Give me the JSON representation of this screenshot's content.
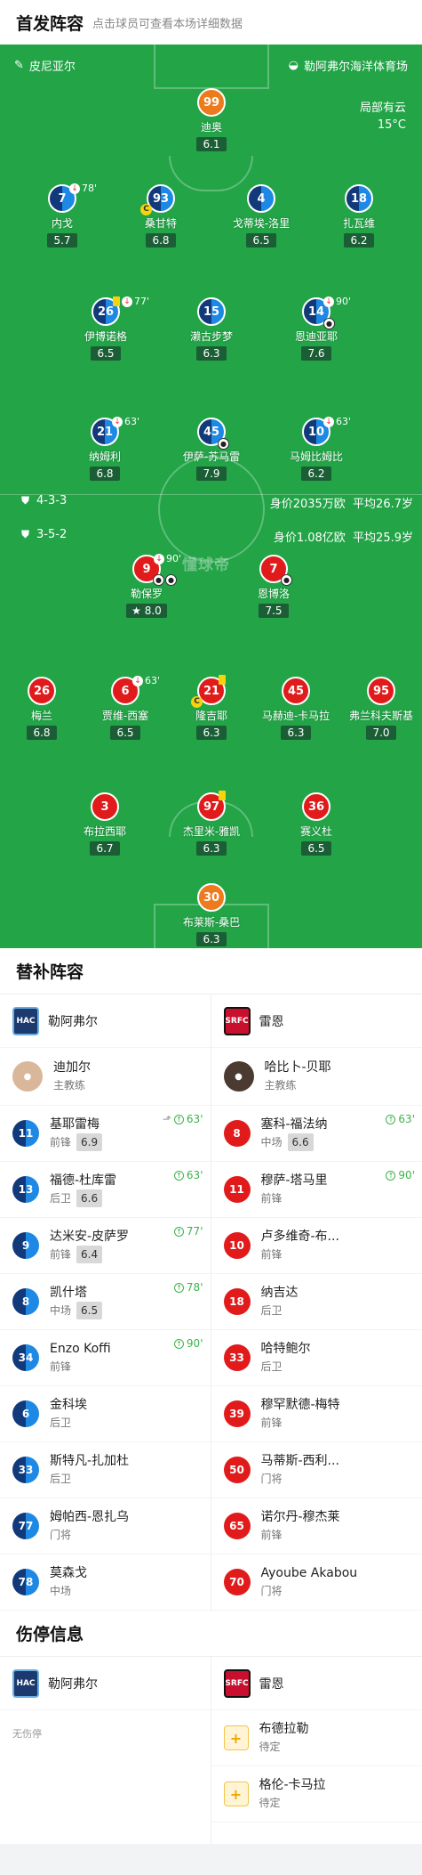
{
  "header": {
    "title": "首发阵容",
    "subtitle": "点击球员可查看本场详细数据"
  },
  "pitch": {
    "home_label": "皮尼亚尔",
    "venue": "勒阿弗尔海洋体育场",
    "weather": "局部有云",
    "temp": "15°C",
    "watermark": "懂球帝",
    "home_formation": "4-3-3",
    "home_value": "身价2035万欧",
    "home_age": "平均26.7岁",
    "away_formation": "3-5-2",
    "away_value": "身价1.08亿欧",
    "away_age": "平均25.9岁",
    "home_players": [
      {
        "num": "99",
        "name": "迪奥",
        "rating": "6.1"
      },
      {
        "num": "7",
        "name": "内戈",
        "rating": "5.7",
        "ev": "78'"
      },
      {
        "num": "93",
        "name": "桑甘特",
        "rating": "6.8"
      },
      {
        "num": "4",
        "name": "戈蒂埃-洛里",
        "rating": "6.5"
      },
      {
        "num": "18",
        "name": "扎瓦维",
        "rating": "6.2"
      },
      {
        "num": "26",
        "name": "伊博诺格",
        "rating": "6.5",
        "ev": "77'"
      },
      {
        "num": "15",
        "name": "濑古步梦",
        "rating": "6.3"
      },
      {
        "num": "14",
        "name": "恩迪亚耶",
        "rating": "7.6",
        "ev": "90'"
      },
      {
        "num": "21",
        "name": "纳姆利",
        "rating": "6.8",
        "ev": "63'"
      },
      {
        "num": "45",
        "name": "伊萨-苏马雷",
        "rating": "7.9"
      },
      {
        "num": "10",
        "name": "马姆比姆比",
        "rating": "6.2",
        "ev": "63'"
      }
    ],
    "away_players": [
      {
        "num": "9",
        "name": "勒保罗",
        "rating": "8.0",
        "ev": "90'"
      },
      {
        "num": "7",
        "name": "恩博洛",
        "rating": "7.5"
      },
      {
        "num": "26",
        "name": "梅兰",
        "rating": "6.8"
      },
      {
        "num": "6",
        "name": "贾维-西塞",
        "rating": "6.5",
        "ev": "63'"
      },
      {
        "num": "21",
        "name": "隆吉耶",
        "rating": "6.3"
      },
      {
        "num": "45",
        "name": "马赫迪-卡马拉",
        "rating": "6.3"
      },
      {
        "num": "95",
        "name": "弗兰科夫斯基",
        "rating": "7.0"
      },
      {
        "num": "3",
        "name": "布拉西耶",
        "rating": "6.7"
      },
      {
        "num": "97",
        "name": "杰里米-雅凯",
        "rating": "6.3"
      },
      {
        "num": "36",
        "name": "赛义杜",
        "rating": "6.5"
      },
      {
        "num": "30",
        "name": "布莱斯-桑巴",
        "rating": "6.3"
      }
    ]
  },
  "subs": {
    "title": "替补阵容",
    "home_team": "勒阿弗尔",
    "away_team": "雷恩",
    "home_coach": {
      "name": "迪加尔",
      "role": "主教练"
    },
    "away_coach": {
      "name": "哈比卜-贝耶",
      "role": "主教练"
    },
    "home": [
      {
        "num": "11",
        "name": "基耶雷梅",
        "pos": "前锋",
        "rating": "6.9",
        "in": "63'"
      },
      {
        "num": "13",
        "name": "福德-杜库雷",
        "pos": "后卫",
        "rating": "6.6",
        "in": "63'"
      },
      {
        "num": "9",
        "name": "达米安-皮萨罗",
        "pos": "前锋",
        "rating": "6.4",
        "in": "77'"
      },
      {
        "num": "8",
        "name": "凯什塔",
        "pos": "中场",
        "rating": "6.5",
        "in": "78'"
      },
      {
        "num": "34",
        "name": "Enzo Koffi",
        "pos": "前锋",
        "in": "90'"
      },
      {
        "num": "6",
        "name": "金科埃",
        "pos": "后卫"
      },
      {
        "num": "33",
        "name": "斯特凡-扎加杜",
        "pos": "后卫"
      },
      {
        "num": "77",
        "name": "姆帕西-恩扎乌",
        "pos": "门将"
      },
      {
        "num": "78",
        "name": "莫森戈",
        "pos": "中场"
      }
    ],
    "away": [
      {
        "num": "8",
        "name": "塞科-福法纳",
        "pos": "中场",
        "rating": "6.6",
        "in": "63'"
      },
      {
        "num": "11",
        "name": "穆萨-塔马里",
        "pos": "前锋",
        "in": "90'"
      },
      {
        "num": "10",
        "name": "卢多维奇-布...",
        "pos": "前锋"
      },
      {
        "num": "18",
        "name": "纳吉达",
        "pos": "后卫"
      },
      {
        "num": "33",
        "name": "哈特鲍尔",
        "pos": "后卫"
      },
      {
        "num": "39",
        "name": "穆罕默德-梅特",
        "pos": "前锋"
      },
      {
        "num": "50",
        "name": "马蒂斯-西利...",
        "pos": "门将"
      },
      {
        "num": "65",
        "name": "诺尔丹-穆杰莱",
        "pos": "前锋"
      },
      {
        "num": "70",
        "name": "Ayoube Akabou",
        "pos": "门将"
      }
    ]
  },
  "injuries": {
    "title": "伤停信息",
    "home_team": "勒阿弗尔",
    "away_team": "雷恩",
    "home_none": "无伤停",
    "away": [
      {
        "name": "布德拉勒",
        "status": "待定"
      },
      {
        "name": "格伦-卡马拉",
        "status": "待定"
      }
    ]
  },
  "colors": {
    "pitch": "#22a447",
    "home_gk": "#ee7a1e",
    "home_dark": "#123a7a",
    "home_light": "#1e88e5",
    "away": "#e11b1b"
  }
}
